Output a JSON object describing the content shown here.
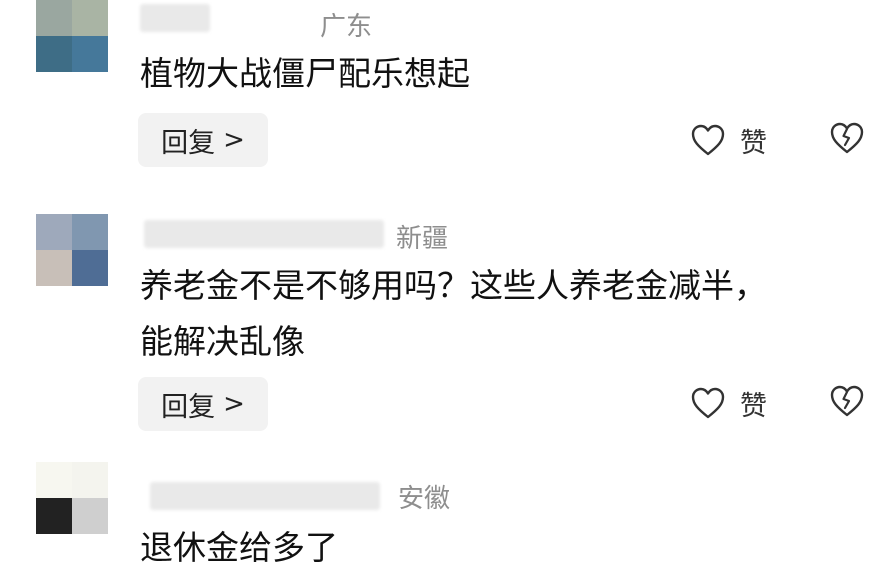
{
  "comments": [
    {
      "region": "广东",
      "text": "植物大战僵尸配乐想起",
      "reply_label": "回复",
      "reply_chevron": ">",
      "like_label": "赞",
      "avatar_colors": [
        "#9aa7a0",
        "#a9b4a4",
        "#3e6d86",
        "#45789a"
      ]
    },
    {
      "region": "新疆",
      "text_line1": "养老金不是不够用吗？这些人养老金减半，",
      "text_line2": "能解决乱像",
      "reply_label": "回复",
      "reply_chevron": ">",
      "like_label": "赞",
      "avatar_colors": [
        "#9ea9bb",
        "#8097b0",
        "#c8bfb8",
        "#4f6d95"
      ]
    },
    {
      "region": "安徽",
      "text": "退休金给多了",
      "avatar_colors": [
        "#f7f7f0",
        "#f4f4ee",
        "#222222",
        "#cfcfcf"
      ]
    }
  ],
  "icons": {
    "like": "heart-outline-icon",
    "dislike": "broken-heart-icon"
  },
  "colors": {
    "region_text": "#8e8e8e",
    "reply_bg": "#f2f2f2",
    "icon_stroke": "#333333"
  }
}
